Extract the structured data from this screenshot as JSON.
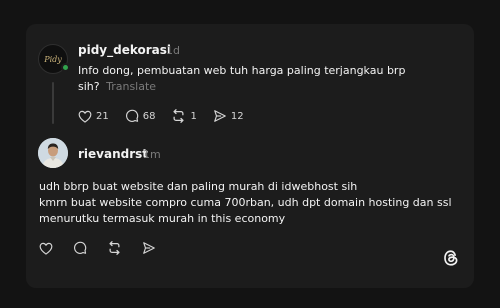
{
  "post": {
    "username": "pidy_dekorasi",
    "time": "1d",
    "avatar_text": "Pidy",
    "text": "Info dong, pembuatan web tuh harga paling terjangkau brp sih?",
    "translate_label": "Translate",
    "likes": "21",
    "replies": "68",
    "reposts": "1",
    "shares": "12"
  },
  "reply": {
    "username": "rievandrst",
    "time": "1m",
    "lines": [
      "udh bbrp buat website dan paling murah di idwebhost sih",
      "kmrn buat website compro cuma 700rban, udh dpt domain hosting dan ssl",
      "menurutku termasuk murah in this economy"
    ]
  },
  "icons": {
    "like": "heart-icon",
    "reply": "comment-icon",
    "repost": "repost-icon",
    "share": "send-icon",
    "brand": "threads-logo-icon"
  },
  "colors": {
    "background": "#131313",
    "card": "#1c1c1c",
    "text": "#f3f3f3",
    "muted": "#7a7a7a",
    "online": "#31a24c"
  }
}
